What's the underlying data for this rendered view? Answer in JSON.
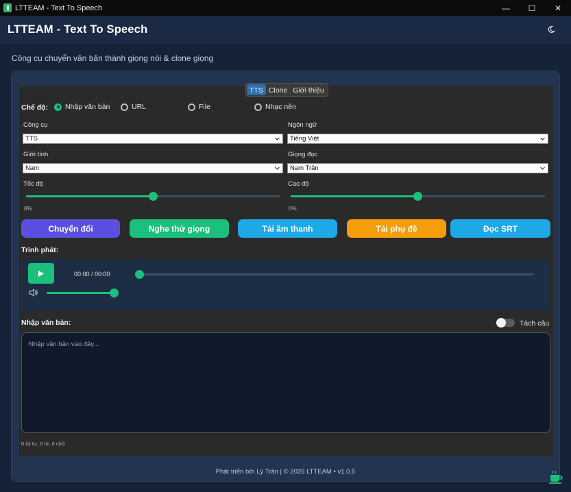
{
  "window": {
    "title": "LTTEAM - Text To Speech",
    "controls": {
      "minimize": "—",
      "maximize": "☐",
      "close": "✕"
    }
  },
  "header": {
    "title": "LTTEAM - Text To Speech",
    "theme_icon": "moon-icon"
  },
  "subtitle": "Công cụ chuyển văn bản thành giọng nói & clone giọng",
  "tabs": [
    {
      "label": "TTS",
      "active": true
    },
    {
      "label": "Clone",
      "active": false
    },
    {
      "label": "Giới thiệu",
      "active": false
    }
  ],
  "mode": {
    "label": "Chế độ:",
    "options": [
      {
        "label": "Nhập văn bản",
        "checked": true
      },
      {
        "label": "URL",
        "checked": false
      },
      {
        "label": "File",
        "checked": false
      },
      {
        "label": "Nhạc nền",
        "checked": false
      }
    ]
  },
  "settings": {
    "tool": {
      "label": "Công cụ",
      "value": "TTS"
    },
    "language": {
      "label": "Ngôn ngữ",
      "value": "Tiếng Việt"
    },
    "gender": {
      "label": "Giới tính",
      "value": "Nam"
    },
    "voice": {
      "label": "Giọng đọc",
      "value": "Nam Trần"
    },
    "speed": {
      "label": "Tốc độ",
      "value_text": "0%",
      "level": 0.5
    },
    "pitch": {
      "label": "Cao độ",
      "value_text": "0%",
      "level": 0.5
    }
  },
  "actions": {
    "convert": "Chuyển đổi",
    "preview": "Nghe thử giọng",
    "download_audio": "Tải âm thanh",
    "download_subtitle": "Tải phụ đề",
    "read_srt": "Đọc SRT"
  },
  "colors": {
    "convert": "#5b4fe0",
    "preview": "#1dbf7c",
    "download_audio": "#1ea8e6",
    "download_subtitle": "#f59e0b",
    "read_srt": "#1ea8e6",
    "accent": "#1dbf7c"
  },
  "player": {
    "label": "Trình phát:",
    "play_icon": "play-icon",
    "time": "00:00 / 00:00",
    "progress": 0,
    "volume_icon": "speaker-icon",
    "volume": 1.0
  },
  "text_input": {
    "label": "Nhập văn bản:",
    "placeholder": "Nhập văn bản vào đây...",
    "value": "",
    "split_sentences_label": "Tách câu",
    "split_sentences_on": false,
    "counter": "0 ký tự, 0 từ, 0 chữ"
  },
  "footer": "Phát triển bởi Lý Trần | © 2025 LTTEAM • v1.0.5"
}
